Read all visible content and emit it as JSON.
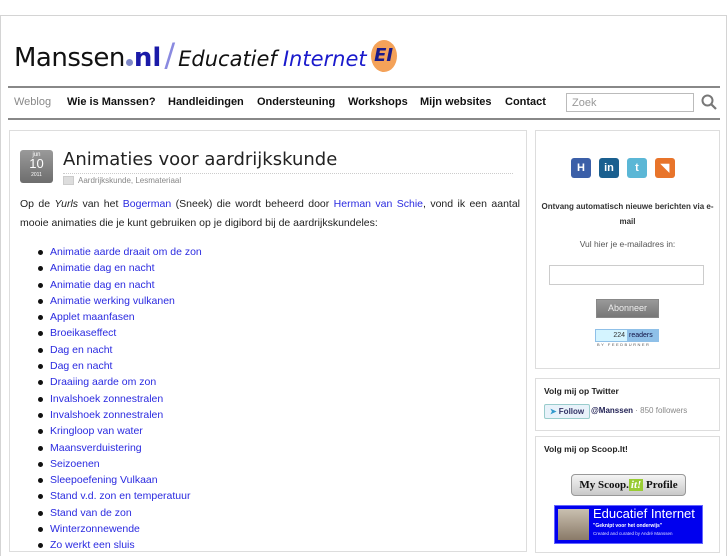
{
  "header": {
    "logo_main": "Manssen",
    "logo_tld": "nl",
    "logo_slash": "/",
    "logo_edu": "Educatief",
    "logo_internet": "Internet",
    "logo_badge": "EI"
  },
  "nav": {
    "items": [
      {
        "label": "Weblog"
      },
      {
        "label": "Wie is Manssen?"
      },
      {
        "label": "Handleidingen"
      },
      {
        "label": "Ondersteuning"
      },
      {
        "label": "Workshops"
      },
      {
        "label": "Mijn websites"
      },
      {
        "label": "Contact"
      }
    ],
    "search_placeholder": "Zoek",
    "search_icon": "search-icon"
  },
  "post": {
    "date_month": "jun",
    "date_day": "10",
    "date_year": "2011",
    "title": "Animaties voor aardrijkskunde",
    "categories": "Aardrijkskunde, Lesmateriaal",
    "intro_1": "Op de ",
    "intro_yurls": "Yurls",
    "intro_2": " van het ",
    "intro_link1": "Bogerman",
    "intro_3": " (Sneek) die wordt beheerd door ",
    "intro_link2": "Herman van Schie",
    "intro_4": ", vond ik een aantal mooie animaties die je kunt gebruiken op je digibord bij de aardrijkskundeles:",
    "links": [
      "Animatie aarde draait om de zon",
      "Animatie dag en nacht",
      "Animatie dag en nacht",
      "Animatie werking vulkanen",
      "Applet maanfasen",
      "Broeikaseffect",
      "Dag en nacht",
      "Dag en nacht",
      "Draaiing aarde om zon",
      "Invalshoek zonnestralen",
      "Invalshoek zonnestralen",
      "Kringloop van water",
      "Maansverduistering",
      "Seizoenen",
      "Sleepoefening Vulkaan",
      "Stand v.d. zon en temperatuur",
      "Stand van de zon",
      "Winterzonnewende",
      "Zo werkt een sluis"
    ]
  },
  "sidebar": {
    "social": [
      {
        "icon": "hyves-icon",
        "glyph": "H",
        "color": "#3b5fa8"
      },
      {
        "icon": "linkedin-icon",
        "glyph": "in",
        "color": "#1a5f8f"
      },
      {
        "icon": "twitter-icon",
        "glyph": "t",
        "color": "#5bb7d6"
      },
      {
        "icon": "rss-icon",
        "glyph": "◥",
        "color": "#e8742a"
      }
    ],
    "subscribe_title": "Ontvang automatisch nieuwe berichten via e-mail",
    "subscribe_prompt": "Vul hier je e-mailadres in:",
    "subscribe_button": "Abonneer",
    "feed_count": "224",
    "feed_label": "readers",
    "feed_by": "BY FEEDBURNER",
    "twitter_title": "Volg mij op Twitter",
    "twitter_follow": "Follow",
    "twitter_handle": "@Manssen",
    "twitter_followers": " · 850 followers",
    "scoop_title": "Volg mij op Scoop.It!",
    "scoop_my": "My Scoop.",
    "scoop_it": "it!",
    "scoop_profile": " Profile",
    "banner_title": "Educatief Internet",
    "banner_sub": "\"Geknipt voor het onderwijs\"",
    "banner_credit": "Created and curated by André Manssen"
  }
}
